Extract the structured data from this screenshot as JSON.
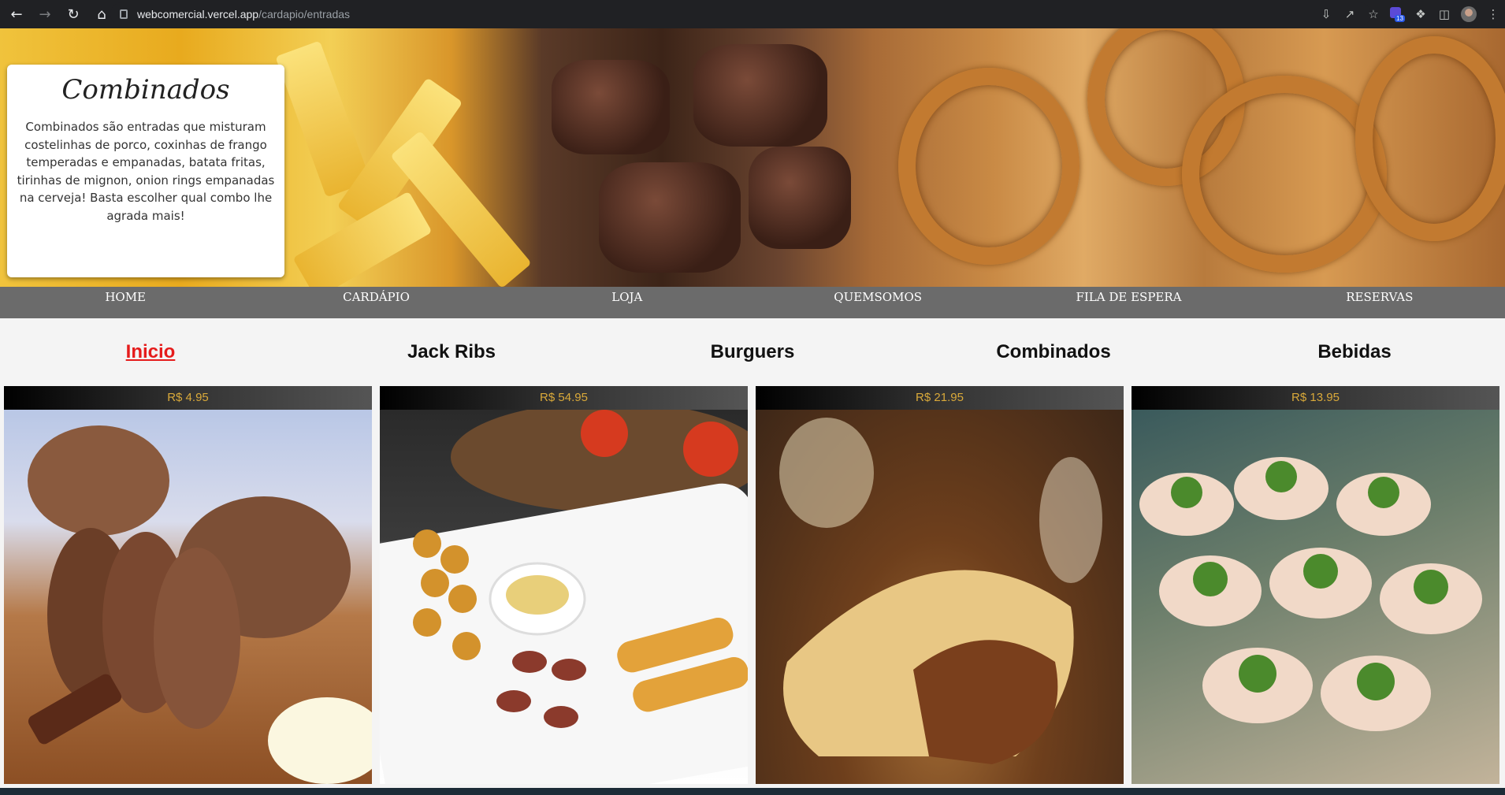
{
  "browser": {
    "url_domain": "webcomercial.vercel.app",
    "url_path": "/cardapio/entradas",
    "extension_badge": "13"
  },
  "hero": {
    "title": "Combinados",
    "description": "Combinados são entradas que misturam costelinhas de porco, coxinhas de frango temperadas e empanadas, batata fritas, tirinhas de mignon, onion rings empanadas na cerveja! Basta escolher qual combo lhe agrada mais!"
  },
  "nav": [
    {
      "label": "HOME"
    },
    {
      "label": "CARDÁPIO"
    },
    {
      "label": "LOJA"
    },
    {
      "label": "QUEMSOMOS"
    },
    {
      "label": "FILA DE ESPERA"
    },
    {
      "label": "RESERVAS"
    }
  ],
  "categories": [
    {
      "label": "Inicio",
      "active": true
    },
    {
      "label": "Jack Ribs"
    },
    {
      "label": "Burguers"
    },
    {
      "label": "Combinados"
    },
    {
      "label": "Bebidas"
    }
  ],
  "products": [
    {
      "price": "R$ 4.95",
      "image": "bread-loaves-with-butter"
    },
    {
      "price": "R$ 54.95",
      "image": "sausage-croquette-platter"
    },
    {
      "price": "R$ 21.95",
      "image": "pastel-with-filling"
    },
    {
      "price": "R$ 13.95",
      "image": "shrimp-skewers"
    }
  ],
  "colors": {
    "nav_bg": "#6b6b6b",
    "active_category": "#e51b1b",
    "price_text": "#d9a93a"
  }
}
